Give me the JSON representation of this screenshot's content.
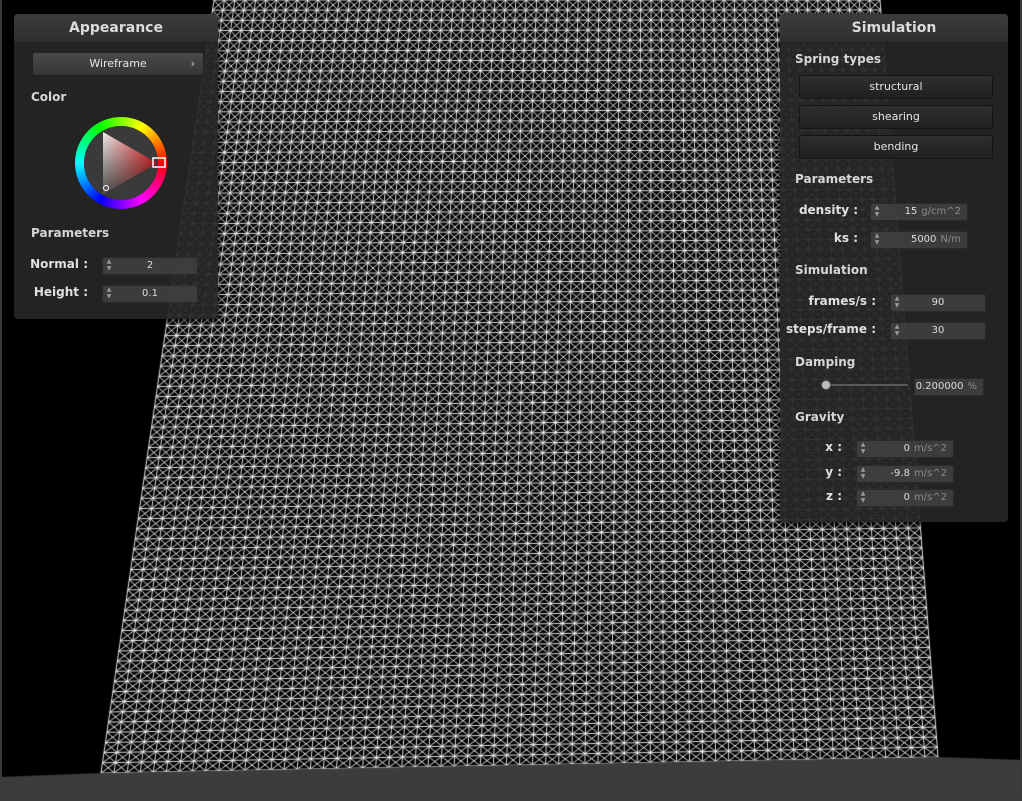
{
  "appearance": {
    "title": "Appearance",
    "shader_dropdown": "Wireframe",
    "color_label": "Color",
    "parameters_label": "Parameters",
    "normal": {
      "label": "Normal :",
      "value": "2"
    },
    "height": {
      "label": "Height :",
      "value": "0.1"
    }
  },
  "simulation": {
    "title": "Simulation",
    "spring_types_label": "Spring types",
    "spring_buttons": [
      "structural",
      "shearing",
      "bending"
    ],
    "parameters_label": "Parameters",
    "density": {
      "label": "density :",
      "value": "15",
      "unit": "g/cm^2"
    },
    "ks": {
      "label": "ks :",
      "value": "5000",
      "unit": "N/m"
    },
    "simulation_label": "Simulation",
    "frames": {
      "label": "frames/s :",
      "value": "90"
    },
    "steps": {
      "label": "steps/frame :",
      "value": "30"
    },
    "damping_label": "Damping",
    "damping": {
      "value": "0.200000",
      "unit": "%",
      "slider_fraction": 0.0
    },
    "gravity_label": "Gravity",
    "gravity_x": {
      "label": "x :",
      "value": "0",
      "unit": "m/s^2"
    },
    "gravity_y": {
      "label": "y :",
      "value": "-9.8",
      "unit": "m/s^2"
    },
    "gravity_z": {
      "label": "z :",
      "value": "0",
      "unit": "m/s^2"
    }
  },
  "cloth": {
    "line_color": "#ffffff",
    "background": "#000000"
  }
}
